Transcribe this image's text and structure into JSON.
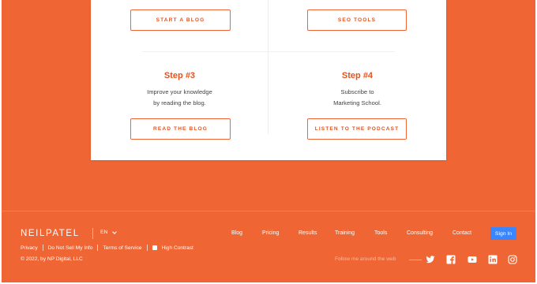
{
  "card": {
    "top_buttons": {
      "left": "START A BLOG",
      "right": "SEO TOOLS"
    },
    "steps": [
      {
        "title": "Step #3",
        "line1": "Improve your knowledge",
        "line2": "by reading the blog.",
        "button": "READ THE BLOG"
      },
      {
        "title": "Step #4",
        "line1": "Subscribe to",
        "line2": "Marketing School.",
        "button": "LISTEN TO THE PODCAST"
      }
    ]
  },
  "footer": {
    "logo": "NEILPATEL",
    "language": "EN",
    "nav": [
      "Blog",
      "Pricing",
      "Results",
      "Training",
      "Tools",
      "Consulting",
      "Contact"
    ],
    "signin": "Sign In",
    "legal": [
      "Privacy",
      "Do Not Sell My Info",
      "Terms of Service"
    ],
    "high_contrast": "High Contrast",
    "copyright": "© 2022, by NP Digital, LLC",
    "follow": "Follow me around the web",
    "social_icons": [
      "twitter-icon",
      "facebook-icon",
      "youtube-icon",
      "linkedin-icon",
      "instagram-icon"
    ]
  },
  "colors": {
    "brand_orange": "#f06534",
    "accent_text": "#e3531f",
    "signin_blue": "#3b86ff"
  }
}
